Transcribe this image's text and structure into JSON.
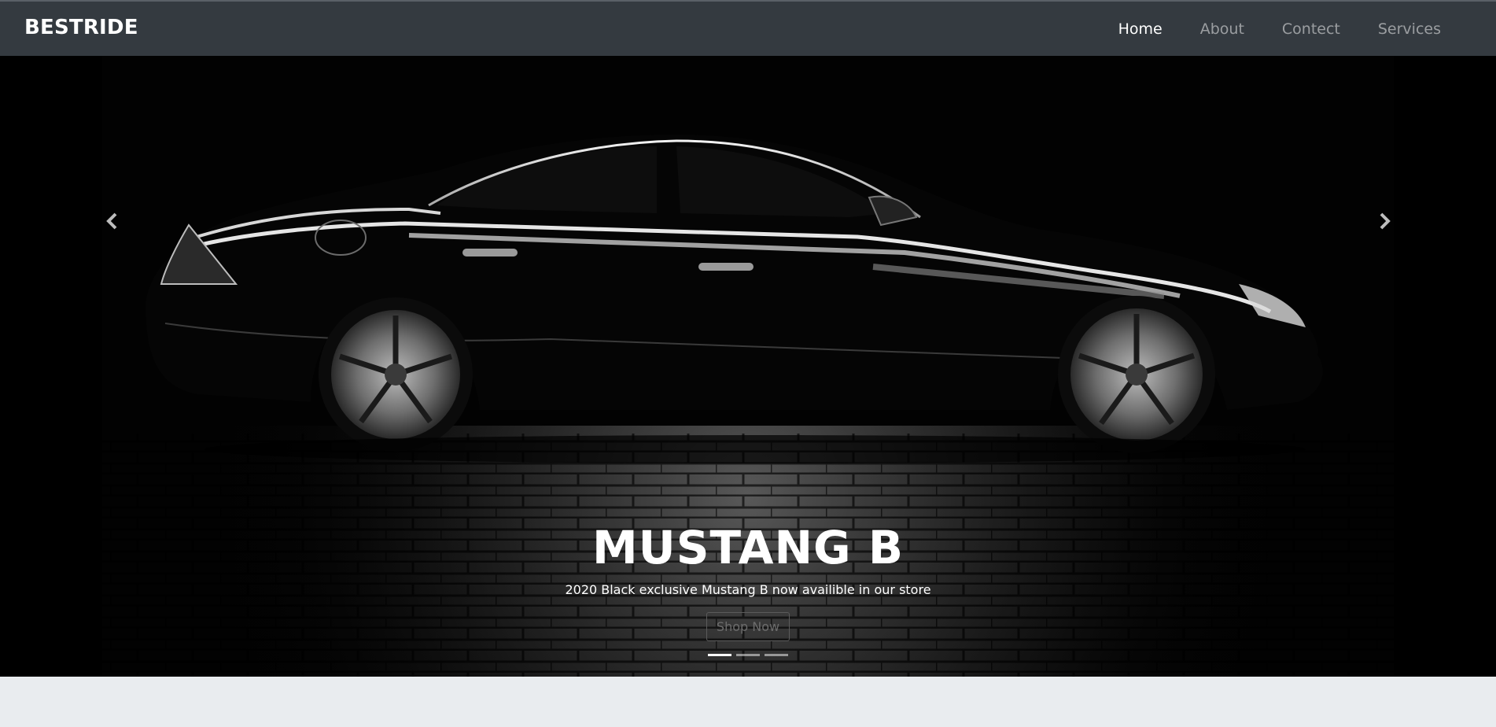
{
  "navbar": {
    "brand": "BESTRIDE",
    "links": [
      {
        "label": "Home",
        "active": true
      },
      {
        "label": "About",
        "active": false
      },
      {
        "label": "Contect",
        "active": false
      },
      {
        "label": "Services",
        "active": false
      }
    ]
  },
  "carousel": {
    "slide_title": "MUSTANG B",
    "slide_text": "2020 Black exclusive Mustang B now availible in our store",
    "button_label": "Shop Now",
    "prev_icon": "chevron-left-icon",
    "next_icon": "chevron-right-icon",
    "indicator_count": 3,
    "active_indicator": 1
  },
  "colors": {
    "navbar_bg": "#343a40",
    "page_bg": "#e9ecef",
    "hero_bg": "#020202"
  }
}
